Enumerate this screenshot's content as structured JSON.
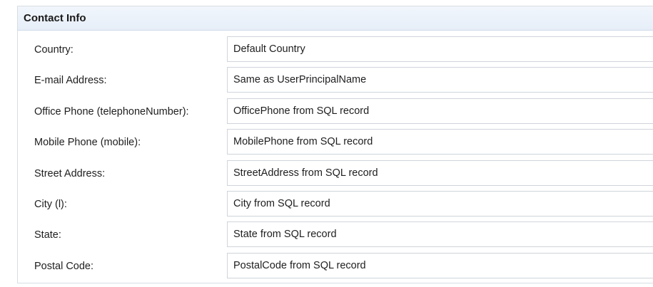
{
  "section": {
    "title": "Contact Info"
  },
  "fields": [
    {
      "label": "Country:",
      "value": "Default Country"
    },
    {
      "label": "E-mail Address:",
      "value": "Same as UserPrincipalName"
    },
    {
      "label": "Office Phone (telephoneNumber):",
      "value": "OfficePhone from SQL record"
    },
    {
      "label": "Mobile Phone (mobile):",
      "value": "MobilePhone from SQL record"
    },
    {
      "label": "Street Address:",
      "value": "StreetAddress from SQL record"
    },
    {
      "label": "City (l):",
      "value": "City from SQL record"
    },
    {
      "label": "State:",
      "value": "State from SQL record"
    },
    {
      "label": "Postal Code:",
      "value": "PostalCode from SQL record"
    }
  ]
}
